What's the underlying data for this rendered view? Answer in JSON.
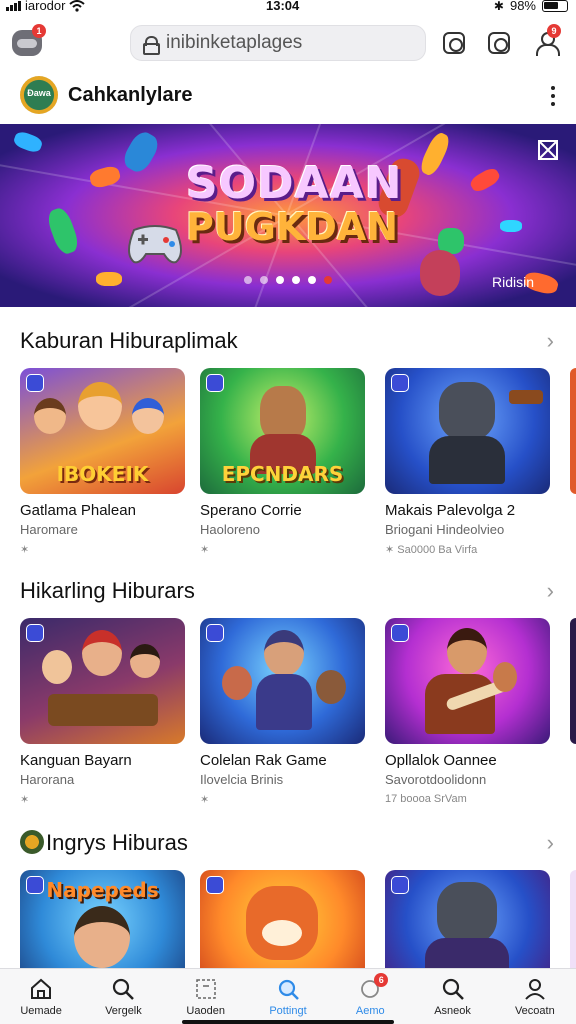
{
  "status_bar": {
    "carrier": "iarodor",
    "time": "13:04",
    "battery": "98%"
  },
  "top_bar": {
    "search_text": "inibinketaplages",
    "notif_badge": "1",
    "profile_badge": "9"
  },
  "store": {
    "name": "Cahkanlylare",
    "logo_text": "Đawa"
  },
  "banner": {
    "title_line1": "SODAAN",
    "title_line2": "PUGKDAN",
    "link": "Ridisin"
  },
  "sections": [
    {
      "title": "Kaburan Hiburaplimak",
      "cards": [
        {
          "name": "Gatlama Phalean",
          "sub": "Haromare",
          "meta": "✶",
          "thumb_title": "IBOKEIK"
        },
        {
          "name": "Sperano Corrie",
          "sub": "Haoloreno",
          "meta": "✶",
          "thumb_title": "EPCNDARS"
        },
        {
          "name": "Makais Palevolga 2",
          "sub": "Briogani Hindeolvieo",
          "meta": "✶ Sa0000 Ba Virfa",
          "thumb_title": ""
        }
      ]
    },
    {
      "title": "Hikarling Hiburars",
      "cards": [
        {
          "name": "Kanguan Bayarn",
          "sub": "Harorana",
          "meta": "✶",
          "thumb_title": ""
        },
        {
          "name": "Colelan Rak Game",
          "sub": "Ilovelcia Brinis",
          "meta": "✶",
          "thumb_title": ""
        },
        {
          "name": "Opllalok Oannee",
          "sub": "Savorotdoolidonn",
          "meta": "17 boooa SrVam",
          "thumb_title": ""
        }
      ]
    },
    {
      "title": "Ingrys Hiburas",
      "cards": [
        {
          "thumb_title": "Napepeds"
        },
        {
          "thumb_title": ""
        },
        {
          "thumb_title": ""
        }
      ]
    }
  ],
  "bottom_nav": [
    {
      "label": "Uemade",
      "icon": "home-icon"
    },
    {
      "label": "Vergelk",
      "icon": "search-icon"
    },
    {
      "label": "Uaoden",
      "icon": "frame-icon"
    },
    {
      "label": "Pottingt",
      "icon": "search-active-icon",
      "active": true
    },
    {
      "label": "Aemo",
      "icon": "bubble-icon",
      "badge": "6"
    },
    {
      "label": "Asneok",
      "icon": "search-icon"
    },
    {
      "label": "Vecoatn",
      "icon": "person-icon"
    }
  ],
  "colors": {
    "accent": "#2f8be8",
    "badge": "#e53935",
    "text": "#111111"
  }
}
